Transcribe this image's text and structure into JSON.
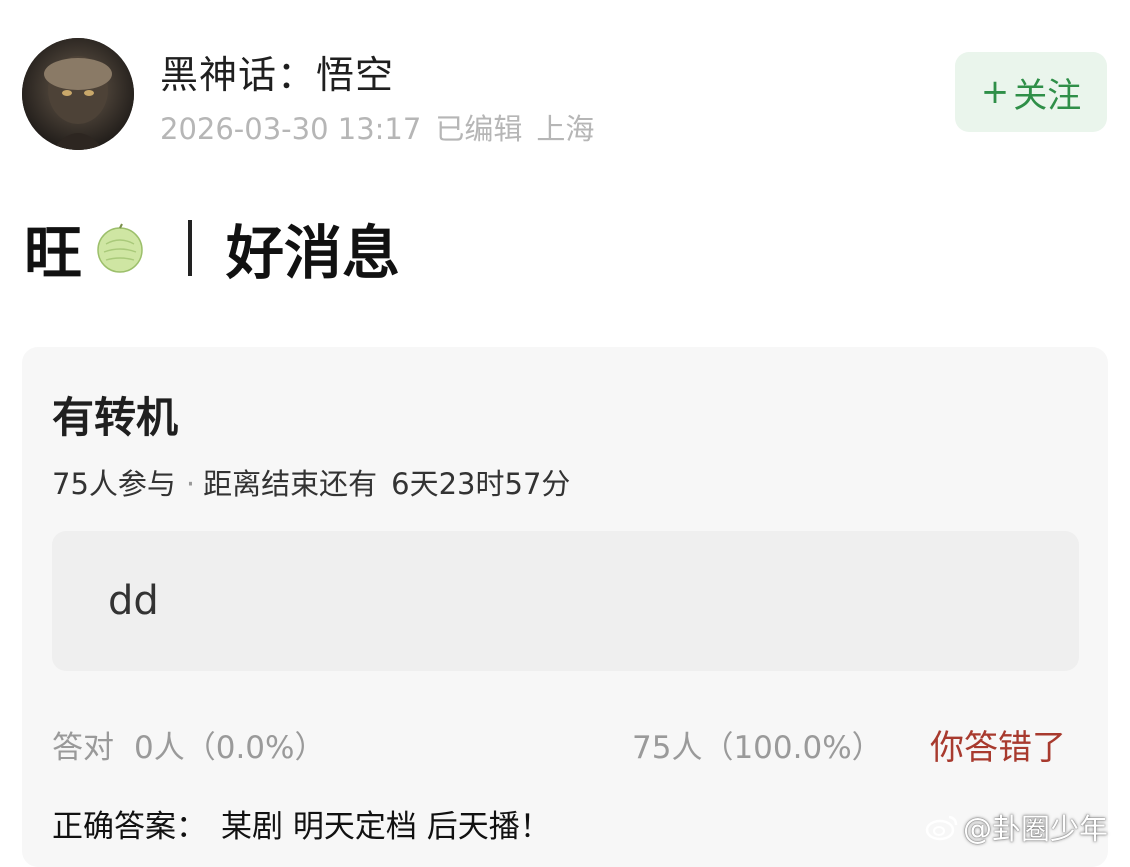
{
  "post": {
    "author": "黑神话：悟空",
    "date": "2026-03-30 13:17",
    "edited": "已编辑",
    "location": "上海",
    "follow": {
      "plus": "+",
      "label": "关注"
    },
    "title_prefix": "旺",
    "title_emoji": "melon-emoji",
    "title_main": "好消息"
  },
  "quiz": {
    "title": "有转机",
    "participants": "75人参与",
    "separator": "·",
    "countdown_label": "距离结束还有",
    "countdown_value": "6天23时57分",
    "option_text": "dd",
    "correct_label": "答对",
    "correct_count": "0人（0.0%）",
    "wrong_count": "75人（100.0%）",
    "result_label": "你答错了",
    "answer_label": "正确答案：",
    "answer_text": "某剧 明天定档 后天播！"
  },
  "watermark": {
    "text": "@卦圈少年",
    "icon": "weibo-icon"
  },
  "colors": {
    "accent_green": "#2f8f48",
    "follow_bg": "#eaf5ec",
    "wrong_red": "#a83a2e",
    "card_bg": "#f7f7f7"
  }
}
